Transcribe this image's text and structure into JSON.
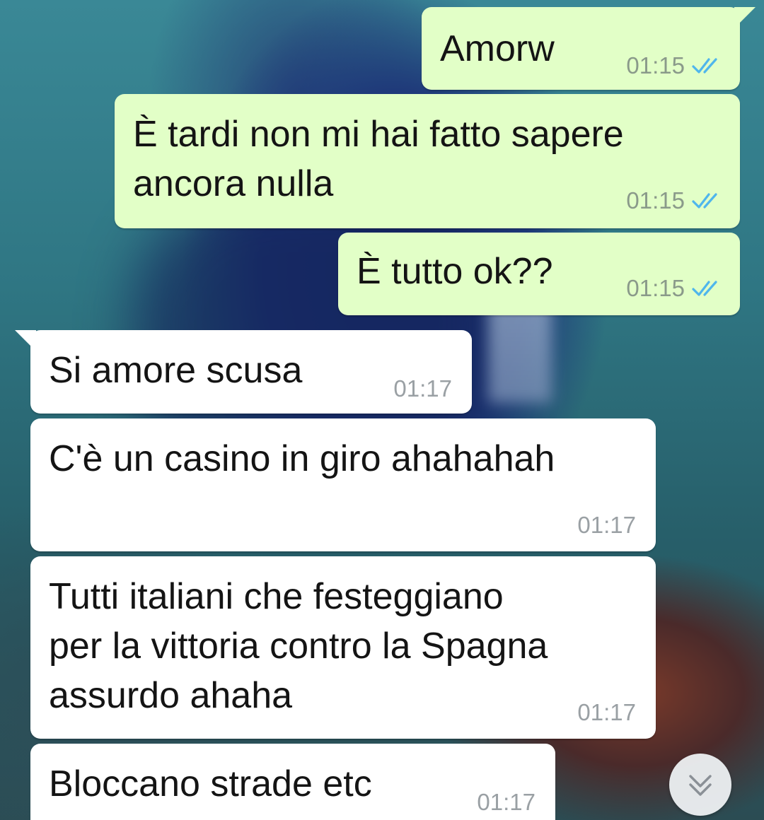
{
  "messages": [
    {
      "id": "m1",
      "direction": "outgoing",
      "text": "Amorw",
      "time": "01:15",
      "status": "read"
    },
    {
      "id": "m2",
      "direction": "outgoing",
      "text": "È tardi non mi hai fatto sapere\nancora nulla",
      "time": "01:15",
      "status": "read"
    },
    {
      "id": "m3",
      "direction": "outgoing",
      "text": "È tutto ok??",
      "time": "01:15",
      "status": "read"
    },
    {
      "id": "m4",
      "direction": "incoming",
      "text": "Si amore scusa",
      "time": "01:17"
    },
    {
      "id": "m5",
      "direction": "incoming",
      "text": "C'è un casino in giro ahahahah",
      "time": "01:17"
    },
    {
      "id": "m6",
      "direction": "incoming",
      "text": "Tutti italiani che festeggiano\nper la vittoria contro la Spagna\nassurdo ahaha",
      "time": "01:17"
    },
    {
      "id": "m7",
      "direction": "incoming",
      "text": "Bloccano strade etc",
      "time": "01:17"
    }
  ],
  "icons": {
    "read_receipt": "double-check-icon",
    "scroll_down": "double-chevron-down-icon"
  },
  "colors": {
    "outgoing_bubble": "#e2ffc7",
    "incoming_bubble": "#ffffff",
    "read_tick": "#4fb6ec",
    "timestamp": "#8a9a8a"
  }
}
